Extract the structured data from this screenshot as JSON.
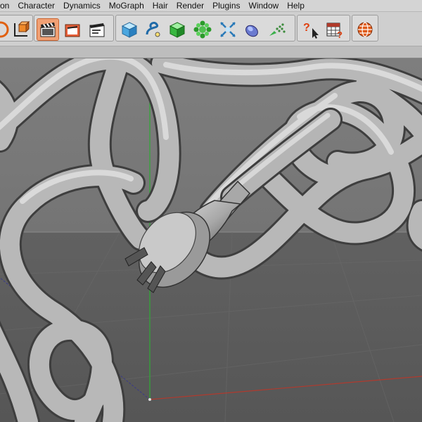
{
  "menu": {
    "items": [
      "on",
      "Character",
      "Dynamics",
      "MoGraph",
      "Hair",
      "Render",
      "Plugins",
      "Window",
      "Help"
    ]
  },
  "toolbar": {
    "buttons": [
      "render-region-icon",
      "coordinate-system-icon",
      "clapboard-active-icon",
      "render-view-icon",
      "render-settings-icon",
      "cube-primitive-icon",
      "spline-icon",
      "nurbs-icon",
      "array-icon",
      "deformer-icon",
      "environment-icon",
      "particles-icon",
      "help-pointer-icon",
      "table-help-icon",
      "globe-icon"
    ]
  },
  "colors": {
    "accent_active": "#f0a074",
    "axis_y": "#2faa35",
    "axis_x": "#b03a2e",
    "floor": "#5b5b5b",
    "sky": "#7b7b7b"
  }
}
